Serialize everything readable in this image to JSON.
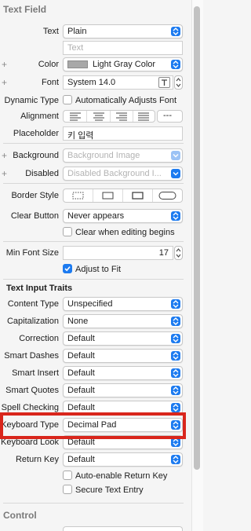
{
  "sections": {
    "text_field": "Text Field",
    "text_input_traits": "Text Input Traits",
    "control": "Control"
  },
  "text": {
    "label": "Text",
    "value": "Plain"
  },
  "text_content": {
    "placeholder": "Text"
  },
  "color": {
    "label": "Color",
    "value": "Light Gray Color",
    "swatch": "#a8a8a8"
  },
  "font": {
    "label": "Font",
    "value": "System 14.0"
  },
  "dynamic_type": {
    "label": "Dynamic Type",
    "checkbox": "Automatically Adjusts Font"
  },
  "alignment": {
    "label": "Alignment",
    "more": "---"
  },
  "placeholder": {
    "label": "Placeholder",
    "value": "키 입력"
  },
  "background": {
    "label": "Background",
    "placeholder": "Background Image"
  },
  "disabled": {
    "label": "Disabled",
    "placeholder": "Disabled Background I..."
  },
  "border_style": {
    "label": "Border Style"
  },
  "clear_button": {
    "label": "Clear Button",
    "value": "Never appears",
    "checkbox": "Clear when editing begins"
  },
  "min_font_size": {
    "label": "Min Font Size",
    "value": "17",
    "checkbox": "Adjust to Fit"
  },
  "traits": {
    "content_type": {
      "label": "Content Type",
      "value": "Unspecified"
    },
    "capitalization": {
      "label": "Capitalization",
      "value": "None"
    },
    "correction": {
      "label": "Correction",
      "value": "Default"
    },
    "smart_dashes": {
      "label": "Smart Dashes",
      "value": "Default"
    },
    "smart_insert": {
      "label": "Smart Insert",
      "value": "Default"
    },
    "smart_quotes": {
      "label": "Smart Quotes",
      "value": "Default"
    },
    "spell_checking": {
      "label": "Spell Checking",
      "value": "Default"
    },
    "keyboard_type": {
      "label": "Keyboard Type",
      "value": "Decimal Pad"
    },
    "keyboard_look": {
      "label": "Keyboard Look",
      "value": "Default"
    },
    "return_key": {
      "label": "Return Key",
      "value": "Default"
    },
    "auto_enable": "Auto-enable Return Key",
    "secure": "Secure Text Entry"
  },
  "colors": {
    "accent": "#1d7bf0",
    "highlight": "#d9261c"
  }
}
